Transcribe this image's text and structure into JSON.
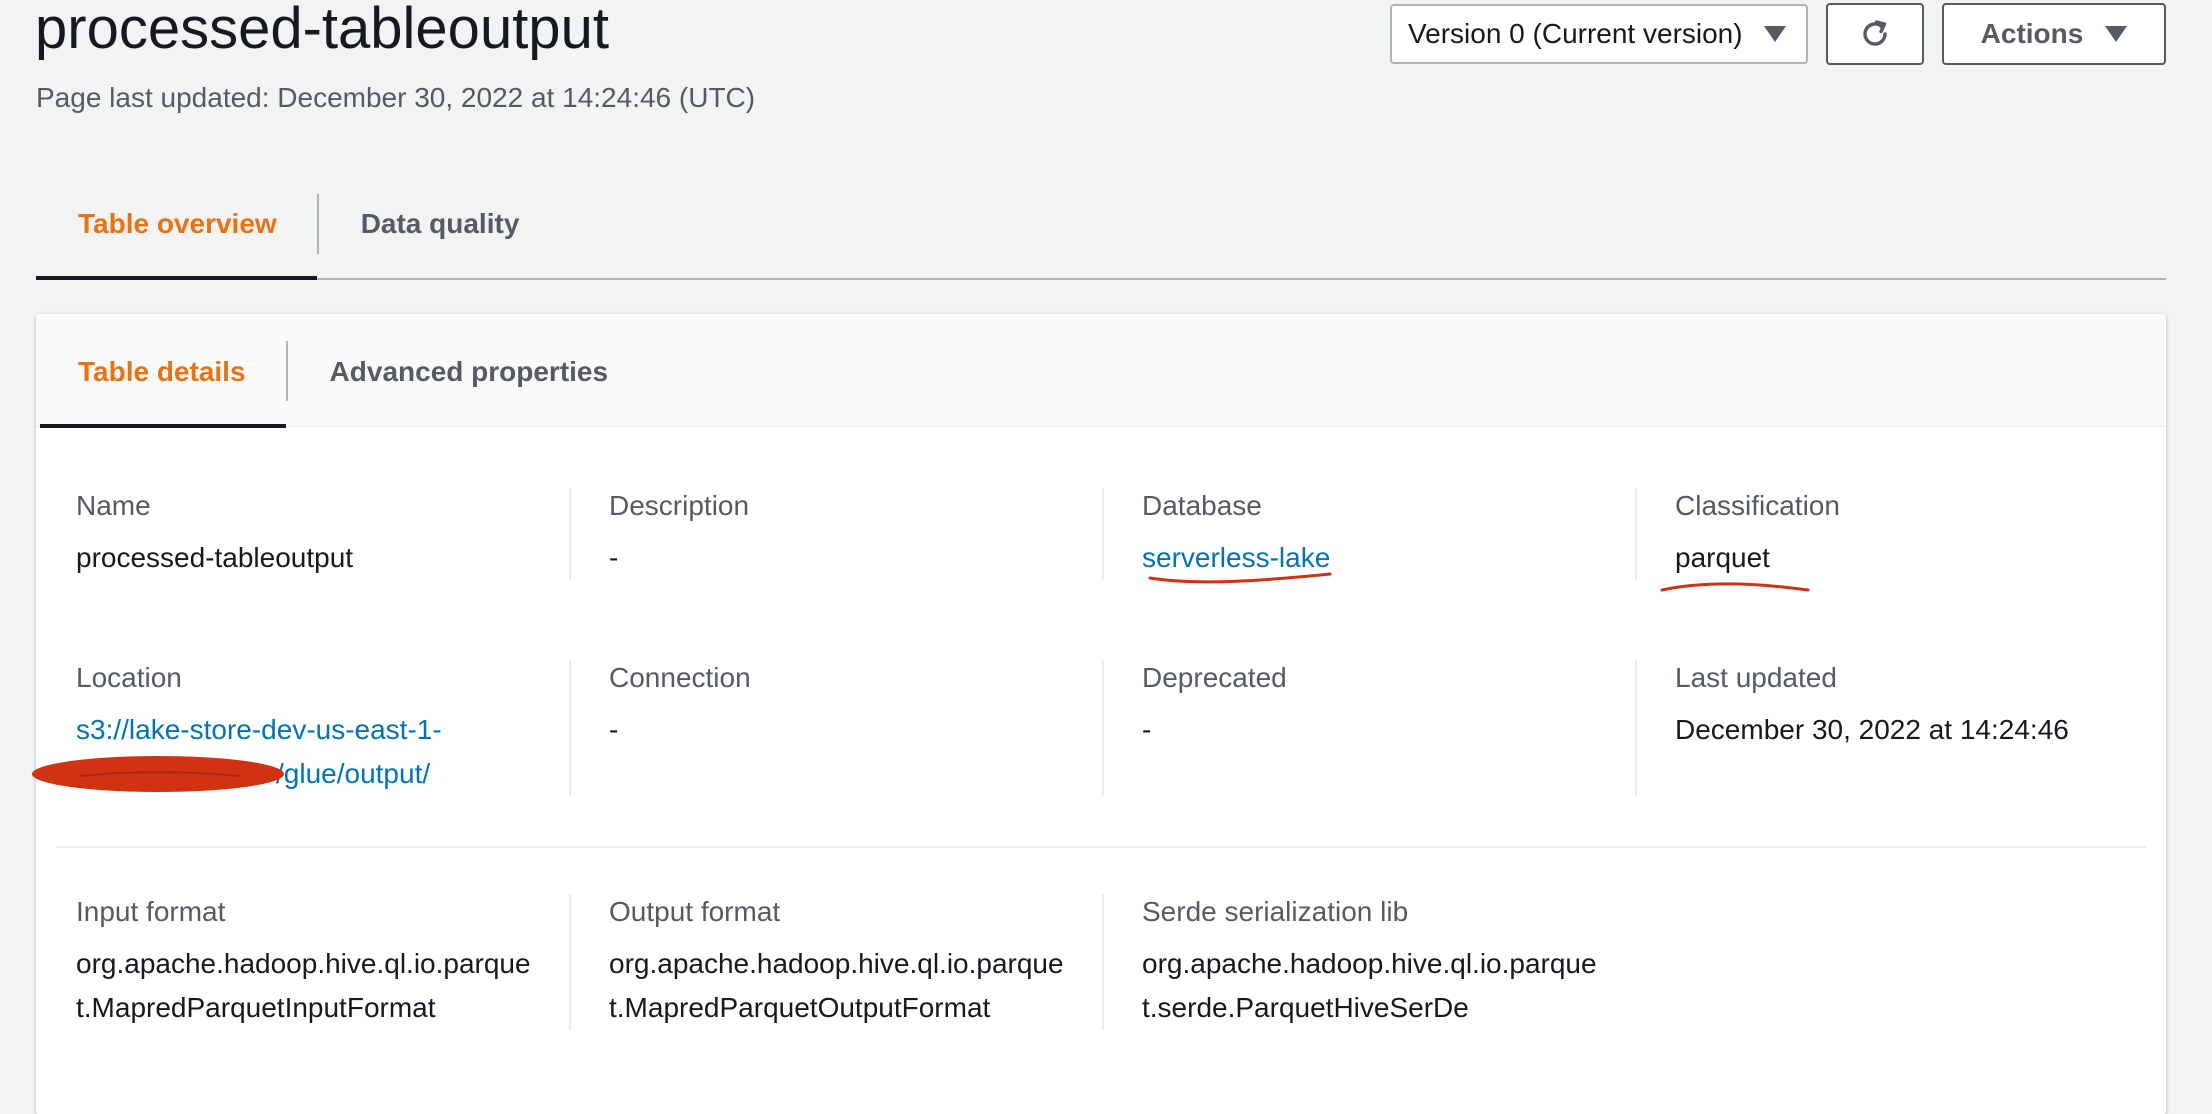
{
  "header": {
    "title": "processed-tableoutput",
    "subtitle": "Page last updated: December 30, 2022 at 14:24:46 (UTC)",
    "version_select": "Version 0 (Current version)",
    "actions_label": "Actions"
  },
  "top_tabs": [
    {
      "label": "Table overview",
      "active": true
    },
    {
      "label": "Data quality",
      "active": false
    }
  ],
  "panel_tabs": [
    {
      "label": "Table details",
      "active": true
    },
    {
      "label": "Advanced properties",
      "active": false
    }
  ],
  "details": {
    "name": {
      "label": "Name",
      "value": "processed-tableoutput"
    },
    "description": {
      "label": "Description",
      "value": "-"
    },
    "database": {
      "label": "Database",
      "value": "serverless-lake"
    },
    "classification": {
      "label": "Classification",
      "value": "parquet"
    },
    "location": {
      "label": "Location",
      "value_line1": "s3://lake-store-dev-us-east-1-",
      "value_line2": "/glue/output/"
    },
    "connection": {
      "label": "Connection",
      "value": "-"
    },
    "deprecated": {
      "label": "Deprecated",
      "value": "-"
    },
    "last_updated": {
      "label": "Last updated",
      "value": "December 30, 2022 at 14:24:46"
    },
    "input_format": {
      "label": "Input format",
      "value": "org.apache.hadoop.hive.ql.io.parquet.MapredParquetInputFormat"
    },
    "output_format": {
      "label": "Output format",
      "value": "org.apache.hadoop.hive.ql.io.parquet.MapredParquetOutputFormat"
    },
    "serde_lib": {
      "label": "Serde serialization lib",
      "value": "org.apache.hadoop.hive.ql.io.parquet.serde.ParquetHiveSerDe"
    }
  },
  "colors": {
    "accent": "#ec7211",
    "link": "#0073bb",
    "annotation": "#d13212"
  },
  "icons": {
    "refresh": "refresh-icon",
    "caret": "caret-down-icon"
  }
}
